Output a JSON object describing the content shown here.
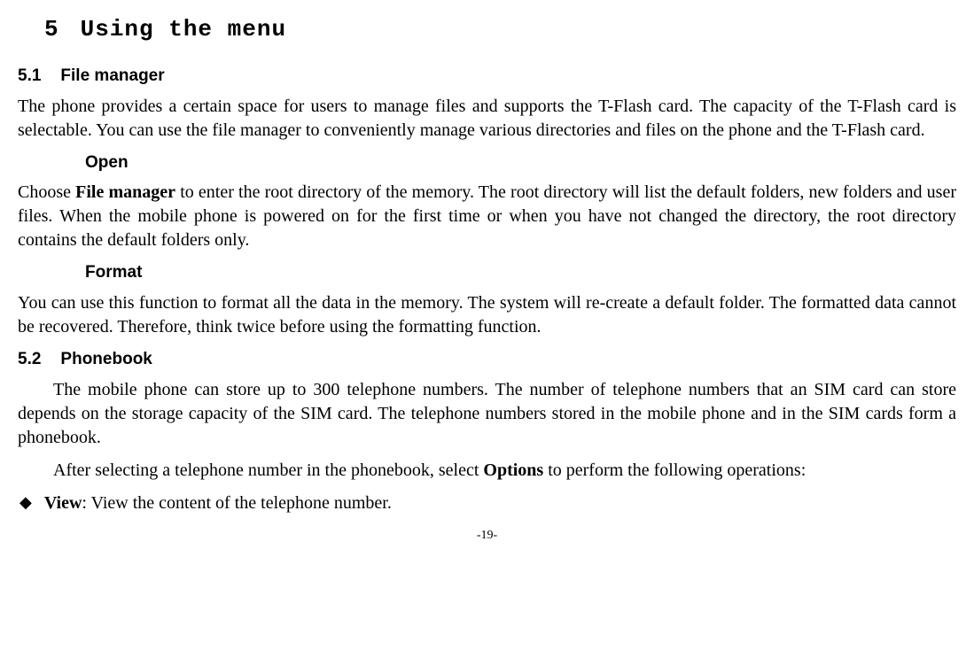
{
  "chapter": {
    "number": "5",
    "title": "Using the menu"
  },
  "sections": {
    "file_manager": {
      "number": "5.1",
      "title": "File manager",
      "intro": "The phone provides a certain space for users to manage files and supports the T-Flash card. The capacity of the T-Flash card is selectable. You can use the file manager to conveniently manage various directories and files on the phone and the T-Flash card.",
      "open": {
        "heading": "Open",
        "before_bold": "Choose ",
        "bold": "File manager",
        "after_bold": " to enter the root directory of the memory. The root directory will list the default folders, new folders and user files. When the mobile phone is powered on for the first time or when you have not changed the directory, the root directory contains the default folders only."
      },
      "format": {
        "heading": "Format",
        "body": "You can use this function to format all the data in the memory. The system will re-create a default folder. The formatted data cannot be recovered. Therefore, think twice before using the formatting function."
      }
    },
    "phonebook": {
      "number": "5.2",
      "title": "Phonebook",
      "para1": "The mobile phone can store up to 300 telephone numbers. The number of telephone numbers that an SIM card can store depends on the storage capacity of the SIM card. The telephone numbers stored in the mobile phone and in the SIM cards form a phonebook.",
      "para2_before": "After selecting a telephone number in the phonebook, select ",
      "para2_bold": "Options",
      "para2_after": " to perform the following operations:",
      "bullets": [
        {
          "label": "View",
          "rest": ": View the content of the telephone number."
        }
      ]
    }
  },
  "page_number": "-19-"
}
